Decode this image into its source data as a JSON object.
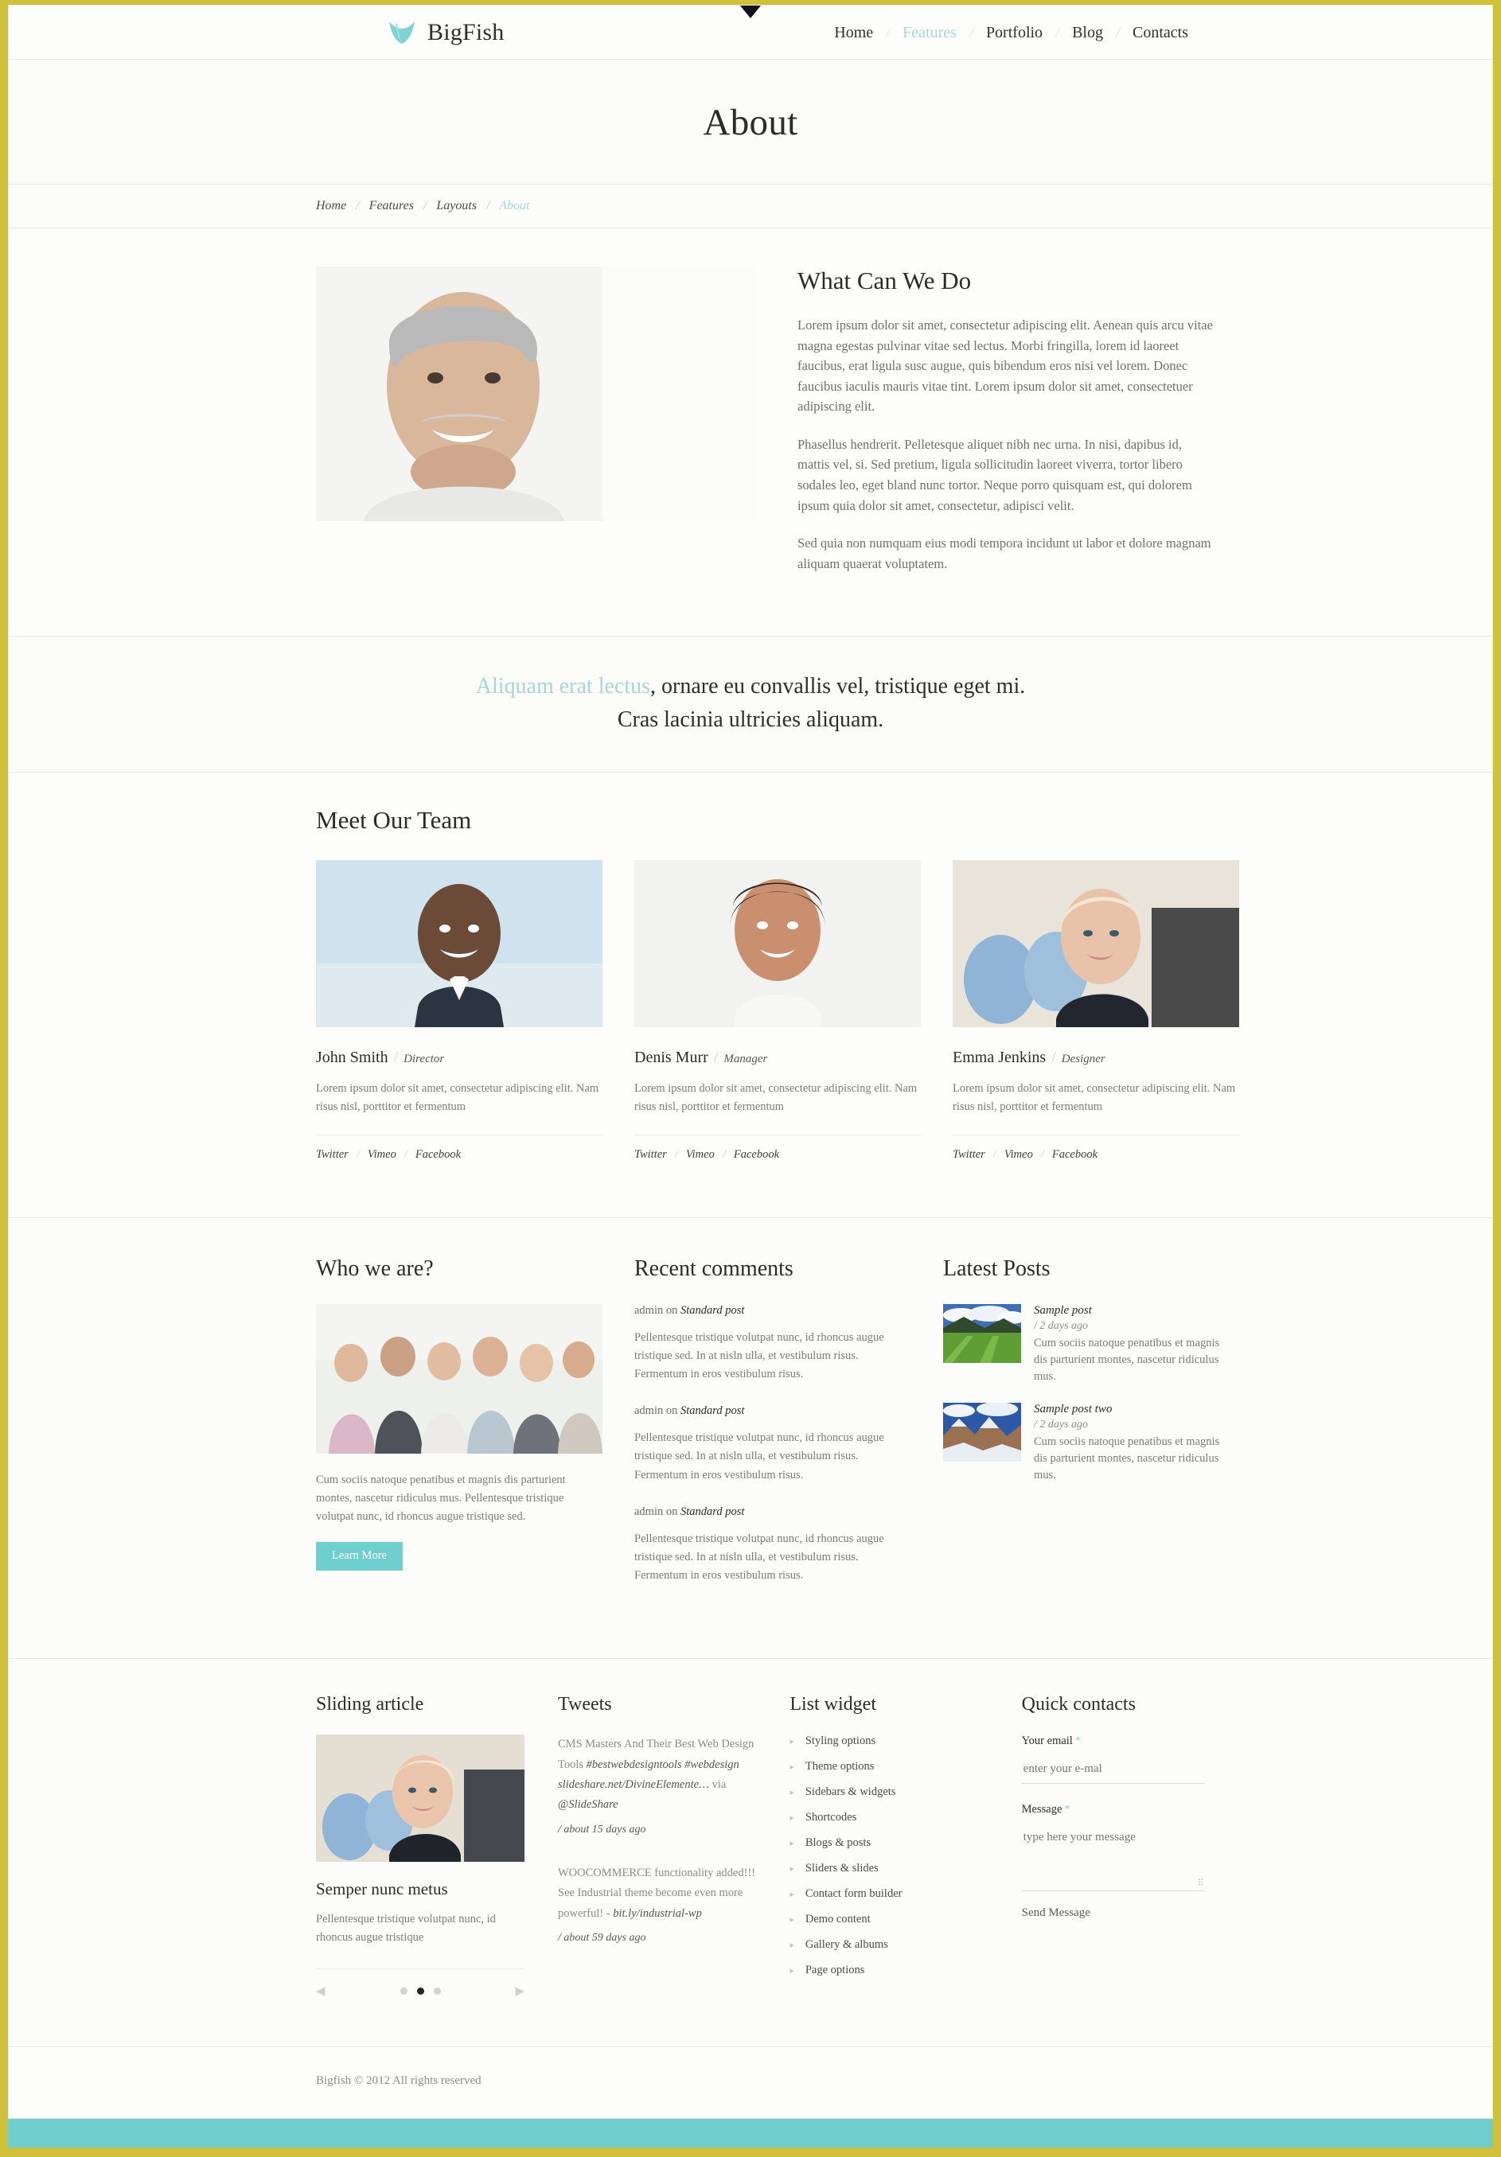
{
  "brand": {
    "name": "BigFish",
    "logo_icon": "bigfish-leaf-icon",
    "accent": "#6fcfcf",
    "border": "#cfc13a"
  },
  "nav": {
    "items": [
      {
        "label": "Home",
        "active": false
      },
      {
        "label": "Features",
        "active": true
      },
      {
        "label": "Portfolio",
        "active": false
      },
      {
        "label": "Blog",
        "active": false
      },
      {
        "label": "Contacts",
        "active": false
      }
    ],
    "separator": "/"
  },
  "page": {
    "title": "About"
  },
  "breadcrumb": {
    "items": [
      {
        "label": "Home",
        "current": false
      },
      {
        "label": "Features",
        "current": false
      },
      {
        "label": "Layouts",
        "current": false
      },
      {
        "label": "About",
        "current": true
      }
    ],
    "separator": "/"
  },
  "about": {
    "image_alt": "smiling-senior-man-portrait",
    "heading": "What Can We Do",
    "paragraphs": [
      "Lorem ipsum dolor sit amet, consectetur adipiscing elit. Aenean quis arcu vitae magna egestas pulvinar vitae sed lectus. Morbi fringilla, lorem id laoreet faucibus, erat ligula susc augue, quis bibendum eros nisi vel lorem. Donec faucibus iaculis mauris vitae tint. Lorem ipsum dolor sit amet, consectetuer adipiscing elit.",
      "Phasellus hendrerit. Pelletesque aliquet nibh nec urna. In nisi, dapibus id, mattis vel, si. Sed pretium, ligula sollicitudin laoreet viverra, tortor libero sodales leo, eget bland nunc tortor. Neque porro quisquam est, qui dolorem ipsum quia dolor sit amet, consectetur, adipisci velit.",
      "Sed quia non numquam eius modi tempora incidunt ut labor et dolore magnam aliquam quaerat voluptatem."
    ]
  },
  "tagline": {
    "highlight": "Aliquam erat lectus",
    "line1_rest": ", ornare eu convallis vel, tristique eget mi.",
    "line2": "Cras lacinia ultricies aliquam."
  },
  "team": {
    "heading": "Meet Our Team",
    "social_separator": "/",
    "members": [
      {
        "name": "John Smith",
        "role": "Director",
        "photo_alt": "smiling-man-in-suit",
        "desc": "Lorem ipsum dolor sit amet, consectetur adipiscing elit. Nam risus nisl, porttitor et fermentum",
        "social": [
          "Twitter",
          "Vimeo",
          "Facebook"
        ]
      },
      {
        "name": "Denis Murr",
        "role": "Manager",
        "photo_alt": "smiling-woman-dark-hair",
        "desc": "Lorem ipsum dolor sit amet, consectetur adipiscing elit. Nam risus nisl, porttitor et fermentum",
        "social": [
          "Twitter",
          "Vimeo",
          "Facebook"
        ]
      },
      {
        "name": "Emma Jenkins",
        "role": "Designer",
        "photo_alt": "blonde-woman-at-office",
        "desc": "Lorem ipsum dolor sit amet, consectetur adipiscing elit. Nam risus nisl, porttitor et fermentum",
        "social": [
          "Twitter",
          "Vimeo",
          "Facebook"
        ]
      }
    ]
  },
  "who_we_are": {
    "heading": "Who we are?",
    "image_alt": "group-of-young-people",
    "text": "Cum sociis natoque penatibus et magnis dis parturient montes, nascetur ridiculus mus. Pellentesque tristique volutpat nunc, id rhoncus augue tristique sed.",
    "button_label": "Learn More"
  },
  "recent_comments": {
    "heading": "Recent comments",
    "items": [
      {
        "author": "admin on",
        "post": "Standard post",
        "body": "Pellentesque tristique volutpat nunc, id rhoncus augue tristique sed. In at nisln ulla, et vestibulum risus. Fermentum in eros vestibulum risus."
      },
      {
        "author": "admin on",
        "post": "Standard post",
        "body": "Pellentesque tristique volutpat nunc, id rhoncus augue tristique sed. In at nisln ulla, et vestibulum risus. Fermentum in eros vestibulum risus."
      },
      {
        "author": "admin on",
        "post": "Standard post",
        "body": "Pellentesque tristique volutpat nunc, id rhoncus augue tristique sed. In at nisln ulla, et vestibulum risus. Fermentum in eros vestibulum risus."
      }
    ]
  },
  "latest_posts": {
    "heading": "Latest Posts",
    "items": [
      {
        "title": "Sample post",
        "date": "/ 2 days ago",
        "excerpt": "Cum sociis natoque penatibus et magnis dis parturient montes, nascetur ridiculus mus.",
        "thumb_alt": "green-valley-mountains"
      },
      {
        "title": "Sample post two",
        "date": "/ 2 days ago",
        "excerpt": "Cum sociis natoque penatibus et magnis dis parturient montes, nascetur ridiculus mus.",
        "thumb_alt": "snowy-rocky-mountain"
      }
    ]
  },
  "sliding_article": {
    "heading": "Sliding article",
    "image_alt": "blonde-businesswoman-at-desk",
    "title": "Semper nunc metus",
    "excerpt": "Pellentesque tristique volutpat nunc, id rhoncus augue tristique",
    "prev_icon": "chevron-left-icon",
    "next_icon": "chevron-right-icon",
    "dots": [
      {
        "active": false
      },
      {
        "active": true
      },
      {
        "active": false
      }
    ]
  },
  "tweets": {
    "heading": "Tweets",
    "items": [
      {
        "text_plain_1": "CMS Masters And Their Best Web Design Tools ",
        "tag_1": "#bestwebdesigntools #webdesign slideshare.net/DivineElemente…",
        "text_plain_2": " via ",
        "handle": "@SlideShare",
        "date": "/ about 15 days ago"
      },
      {
        "text_plain_1": "WOOCOMMERCE functionality added!!! See Industrial theme become even more powerful! - ",
        "tag_1": "bit.ly/industrial-wp",
        "text_plain_2": "",
        "handle": "",
        "date": "/ about 59 days ago"
      }
    ]
  },
  "list_widget": {
    "heading": "List widget",
    "bullet_icon": "triangle-right-icon",
    "items": [
      "Styling options",
      "Theme options",
      "Sidebars & widgets",
      "Shortcodes",
      "Blogs & posts",
      "Sliders & slides",
      "Contact form builder",
      "Demo content",
      "Gallery & albums",
      "Page options"
    ]
  },
  "quick_contacts": {
    "heading": "Quick contacts",
    "email_label": "Your email",
    "email_required": "*",
    "email_value": "",
    "email_placeholder": "enter your e-mal",
    "message_label": "Message",
    "message_required": "*",
    "message_value": "",
    "message_placeholder": "type here your message",
    "send_label": "Send Message"
  },
  "footer": {
    "copyright": "Bigfish © 2012 All rights reserved"
  }
}
